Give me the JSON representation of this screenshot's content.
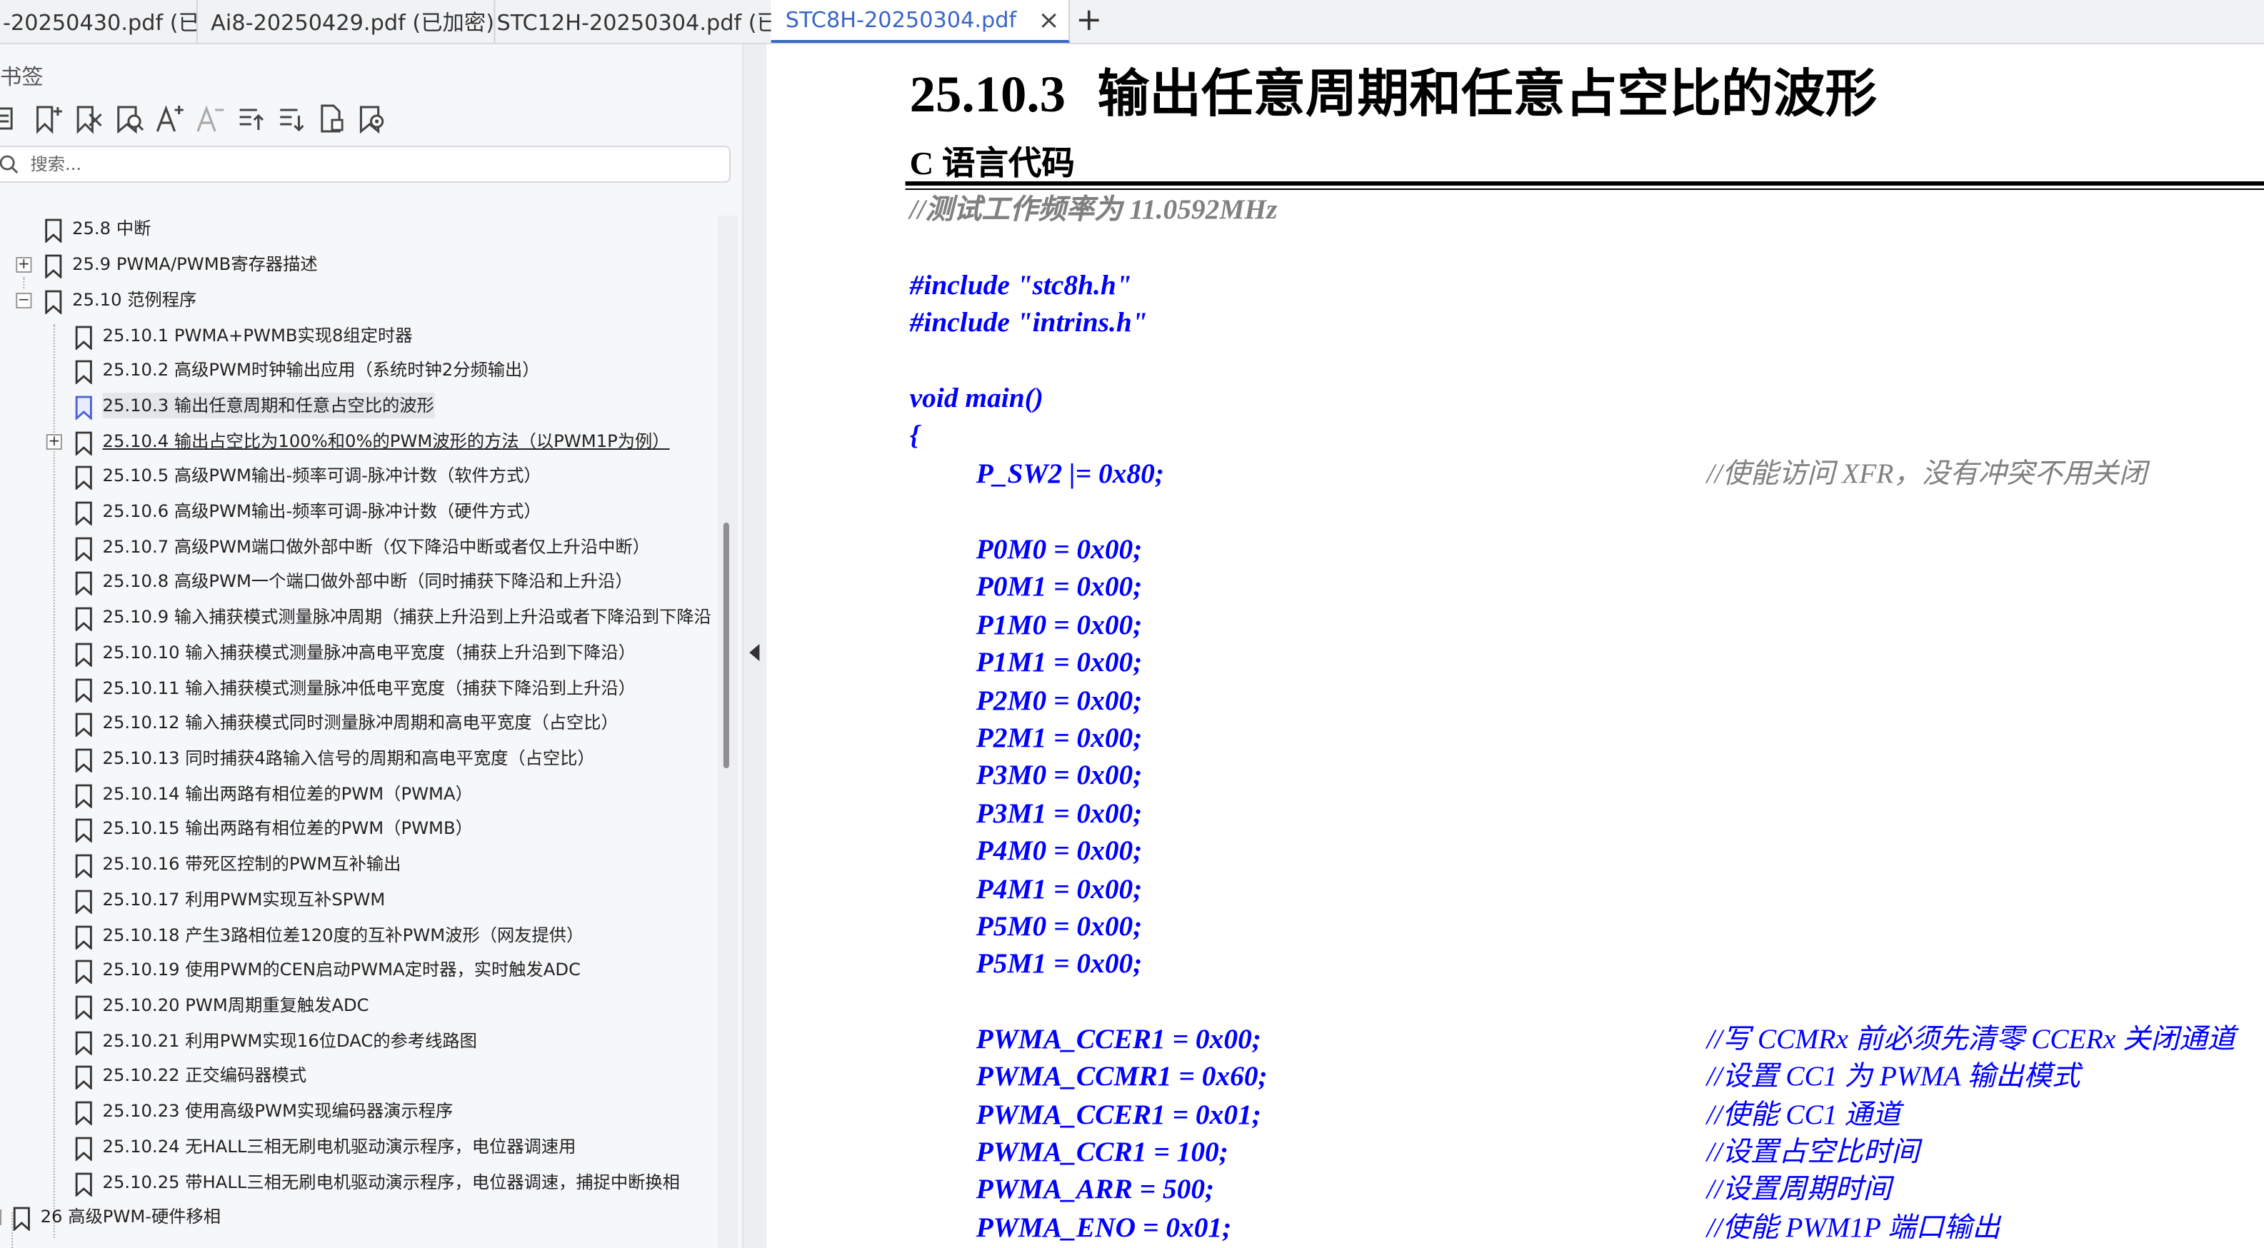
{
  "tabs": [
    {
      "label": "-20250430.pdf (已..."
    },
    {
      "label": "Ai8-20250429.pdf (已加密)"
    },
    {
      "label": "STC12H-20250304.pdf (已..."
    },
    {
      "label": "STC8H-20250304.pdf (..."
    }
  ],
  "tab_close": "×",
  "tab_add": "+",
  "sidebar": {
    "title": "书签",
    "toolbar_icons": [
      "outline-list-icon",
      "add-bookmark-icon",
      "delete-bookmark-icon",
      "find-bookmark-icon",
      "font-increase-icon",
      "font-decrease-icon",
      "expand-all-icon",
      "collapse-all-icon",
      "bookmark-properties-icon",
      "bookmark-current-icon"
    ],
    "search_placeholder": "搜索...",
    "items": [
      {
        "label": "25.8 中断"
      },
      {
        "label": "25.9  PWMA/PWMB寄存器描述",
        "expander": "+"
      },
      {
        "label": "25.10  范例程序",
        "expander": "−"
      },
      {
        "label": "25.10.1 PWMA+PWMB实现8组定时器"
      },
      {
        "label": "25.10.2 高级PWM时钟输出应用（系统时钟2分频输出）"
      },
      {
        "label": "25.10.3 输出任意周期和任意占空比的波形"
      },
      {
        "label": "25.10.4 输出占空比为100%和0%的PWM波形的方法（以PWM1P为例）",
        "expander": "+"
      },
      {
        "label": "25.10.5 高级PWM输出-频率可调-脉冲计数（软件方式）"
      },
      {
        "label": "25.10.6 高级PWM输出-频率可调-脉冲计数（硬件方式）"
      },
      {
        "label": "25.10.7 高级PWM端口做外部中断（仅下降沿中断或者仅上升沿中断）"
      },
      {
        "label": "25.10.8  高级PWM一个端口做外部中断（同时捕获下降沿和上升沿）"
      },
      {
        "label": "25.10.9  输入捕获模式测量脉冲周期（捕获上升沿到上升沿或者下降沿到下降沿"
      },
      {
        "label": "25.10.10 输入捕获模式测量脉冲高电平宽度（捕获上升沿到下降沿）"
      },
      {
        "label": "25.10.11 输入捕获模式测量脉冲低电平宽度（捕获下降沿到上升沿）"
      },
      {
        "label": "25.10.12 输入捕获模式同时测量脉冲周期和高电平宽度（占空比）"
      },
      {
        "label": "25.10.13 同时捕获4路输入信号的周期和高电平宽度（占空比）"
      },
      {
        "label": "25.10.14 输出两路有相位差的PWM（PWMA）"
      },
      {
        "label": "25.10.15 输出两路有相位差的PWM（PWMB）"
      },
      {
        "label": "25.10.16 带死区控制的PWM互补输出"
      },
      {
        "label": "25.10.17 利用PWM实现互补SPWM"
      },
      {
        "label": "25.10.18 产生3路相位差120度的互补PWM波形（网友提供）"
      },
      {
        "label": "25.10.19 使用PWM的CEN启动PWMA定时器，实时触发ADC"
      },
      {
        "label": "25.10.20 PWM周期重复触发ADC"
      },
      {
        "label": "25.10.21 利用PWM实现16位DAC的参考线路图"
      },
      {
        "label": "25.10.22 正交编码器模式"
      },
      {
        "label": "25.10.23 使用高级PWM实现编码器演示程序"
      },
      {
        "label": "25.10.24 无HALL三相无刷电机驱动演示程序，电位器调速用"
      },
      {
        "label": "25.10.25 带HALL三相无刷电机驱动演示程序，电位器调速，捕捉中断换相"
      },
      {
        "label": "26  高级PWM-硬件移相",
        "expander": "+"
      }
    ]
  },
  "document": {
    "heading_number": "25.10.3",
    "heading_title": "输出任意周期和任意占空比的波形",
    "subheading": "C 语言代码",
    "freq_comment": "//测试工作频率为 11.0592MHz",
    "include1": "#include \"stc8h.h\"",
    "include2": "#include \"intrins.h\"",
    "main_decl": "void main()",
    "brace_open": "{",
    "psw2": {
      "code": "P_SW2 |= 0x80;",
      "comment": "//使能访问 XFR，没有冲突不用关闭"
    },
    "port_lines": [
      "P0M0 = 0x00;",
      "P0M1 = 0x00;",
      "P1M0 = 0x00;",
      "P1M1 = 0x00;",
      "P2M0 = 0x00;",
      "P2M1 = 0x00;",
      "P3M0 = 0x00;",
      "P3M1 = 0x00;",
      "P4M0 = 0x00;",
      "P4M1 = 0x00;",
      "P5M0 = 0x00;",
      "P5M1 = 0x00;"
    ],
    "pwm_lines": [
      {
        "code": "PWMA_CCER1 = 0x00;",
        "comment": "//写 CCMRx 前必须先清零 CCERx 关闭通道"
      },
      {
        "code": "PWMA_CCMR1 = 0x60;",
        "comment": "//设置 CC1 为 PWMA 输出模式"
      },
      {
        "code": "PWMA_CCER1 = 0x01;",
        "comment": "//使能 CC1 通道"
      },
      {
        "code": "PWMA_CCR1 = 100;",
        "comment": "//设置占空比时间"
      },
      {
        "code": "PWMA_ARR = 500;",
        "comment": "//设置周期时间"
      },
      {
        "code": "PWMA_ENO = 0x01;",
        "comment": "//使能 PWM1P 端口输出"
      }
    ]
  }
}
